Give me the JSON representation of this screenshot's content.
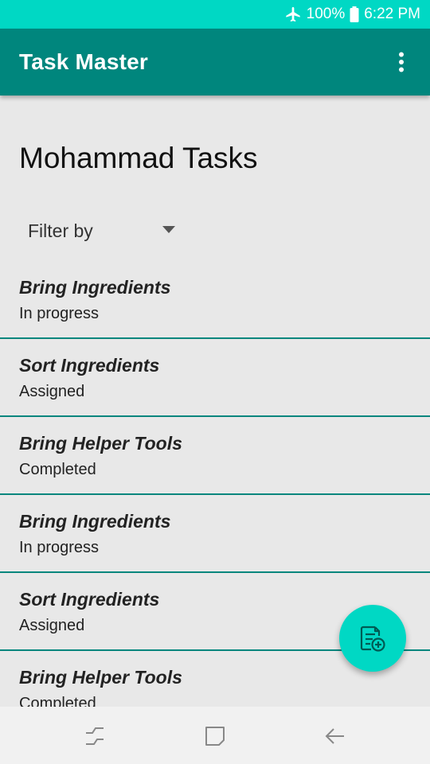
{
  "status_bar": {
    "battery": "100%",
    "time": "6:22 PM",
    "icons": [
      "airplane-mode-icon",
      "battery-icon"
    ]
  },
  "app_bar": {
    "title": "Task Master",
    "menu_icon": "more-vert-icon"
  },
  "main": {
    "page_title": "Mohammad Tasks",
    "filter": {
      "label": "Filter by",
      "icon": "dropdown-arrow-icon"
    },
    "tasks": [
      {
        "name": "Bring Ingredients",
        "status": "In progress"
      },
      {
        "name": "Sort Ingredients",
        "status": "Assigned"
      },
      {
        "name": "Bring Helper Tools",
        "status": "Completed"
      },
      {
        "name": "Bring Ingredients",
        "status": "In progress"
      },
      {
        "name": "Sort Ingredients",
        "status": "Assigned"
      },
      {
        "name": "Bring Helper Tools",
        "status": "Completed"
      }
    ]
  },
  "fab": {
    "icon": "add-task-icon"
  },
  "nav_bar": {
    "icons": [
      "recent-apps-icon",
      "home-icon",
      "back-icon"
    ]
  },
  "colors": {
    "status_bar": "#00d8c4",
    "app_bar": "#00867d",
    "background": "#e8e8e8",
    "divider": "#00867d",
    "fab": "#00d8c4",
    "nav_bar": "#f1f1f1"
  }
}
